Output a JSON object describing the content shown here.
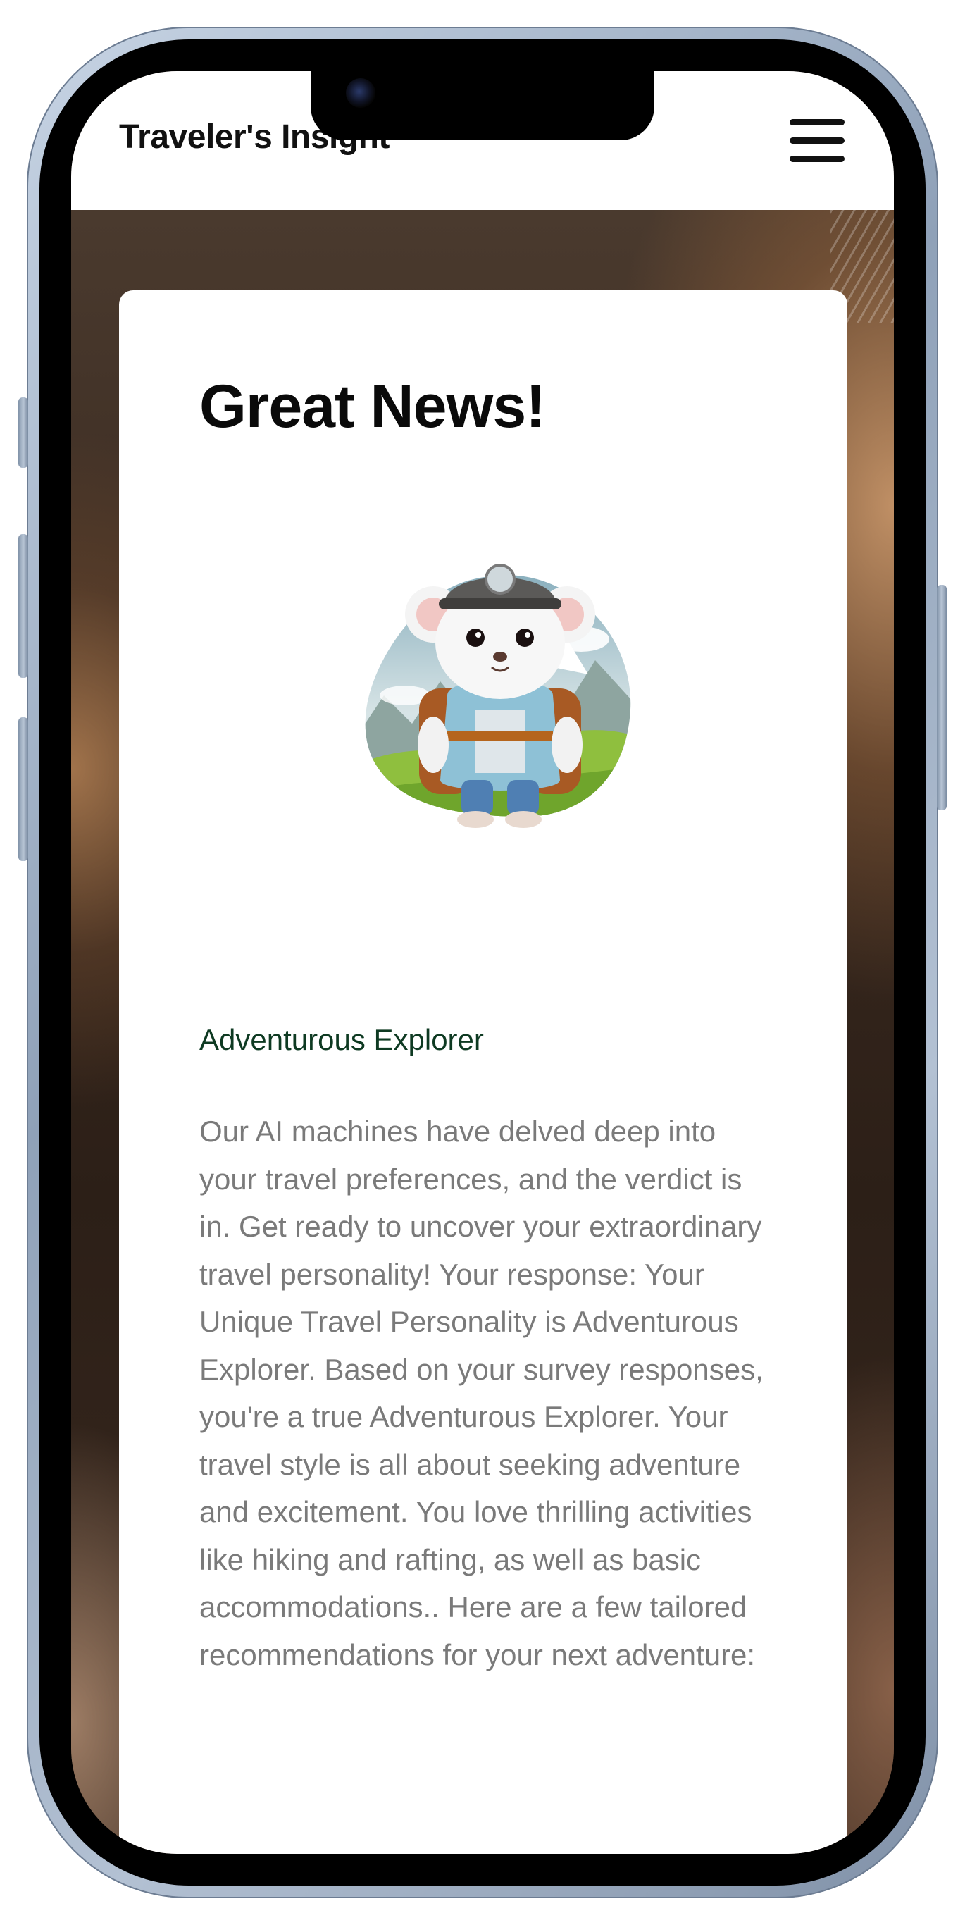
{
  "header": {
    "brand": "Traveler's Insight",
    "menu_icon": "hamburger-menu-icon"
  },
  "card": {
    "title": "Great News!",
    "mascot": "explorer-mouse-mascot",
    "subtitle": "Adventurous Explorer",
    "body": "Our AI machines have delved deep into your travel preferences, and the verdict is in. Get ready to uncover your extraordinary travel personality! Your response: Your Unique Travel Personality is Adventurous Explorer. Based on your survey responses, you're a true Adventurous Explorer. Your travel style is all about seeking adventure and excitement. You love thrilling activities like hiking and rafting, as well as basic accommodations.. Here are a few tailored recommendations for your next adventure:"
  },
  "colors": {
    "subtitle": "#0e3a22",
    "body_text": "#7a7a7a",
    "title": "#0a0a0a",
    "frame": "#8fa1b8"
  }
}
